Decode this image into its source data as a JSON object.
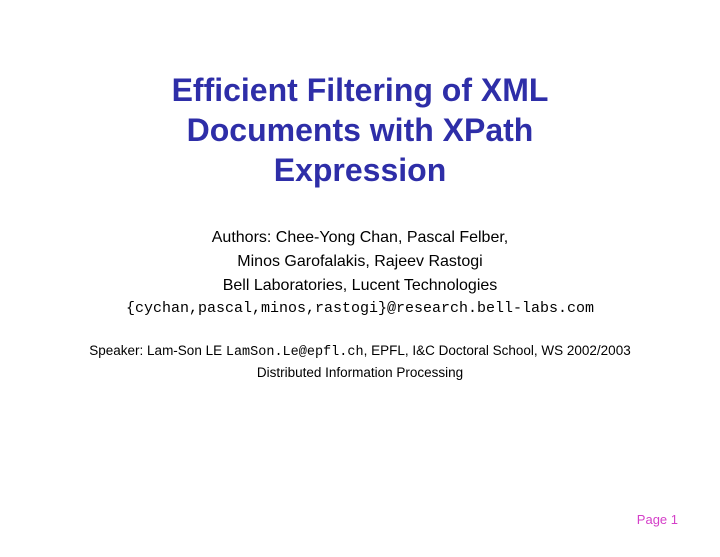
{
  "title": {
    "line1": "Efficient Filtering of XML",
    "line2": "Documents with XPath",
    "line3": "Expression"
  },
  "authors": {
    "line1": "Authors: Chee-Yong Chan, Pascal Felber,",
    "line2": "Minos Garofalakis, Rajeev Rastogi",
    "line3": "Bell Laboratories, Lucent Technologies",
    "emails": "{cychan,pascal,minos,rastogi}@research.bell-labs.com"
  },
  "speaker": {
    "prefix": "Speaker: Lam-Son LE ",
    "email": "LamSon.Le@epfl.ch",
    "suffix": ", EPFL, I&C Doctoral School, WS 2002/2003",
    "line2": "Distributed Information Processing"
  },
  "page": "Page 1"
}
